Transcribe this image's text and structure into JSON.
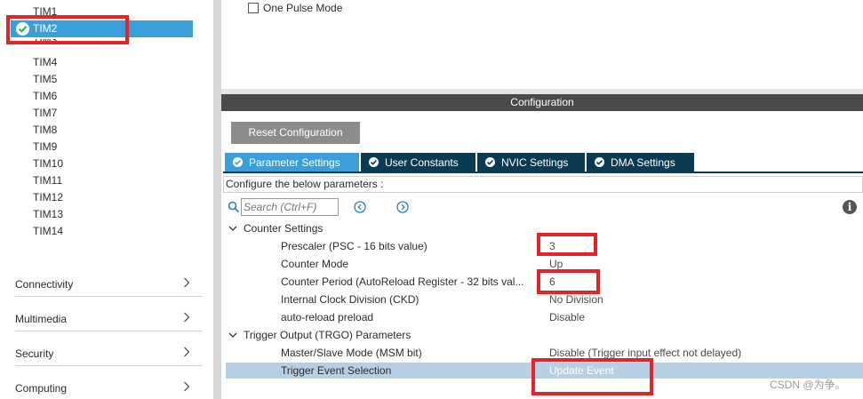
{
  "sidebar": {
    "timers": [
      "TIM1",
      "TIM2",
      "TIM3",
      "TIM4",
      "TIM5",
      "TIM6",
      "TIM7",
      "TIM8",
      "TIM9",
      "TIM10",
      "TIM11",
      "TIM12",
      "TIM13",
      "TIM14"
    ],
    "selected": "TIM2",
    "categories": [
      "Connectivity",
      "Multimedia",
      "Security",
      "Computing"
    ]
  },
  "mode": {
    "one_pulse_label": "One Pulse Mode",
    "one_pulse_checked": false
  },
  "config": {
    "header": "Configuration",
    "reset_button": "Reset Configuration",
    "tabs": [
      "Parameter Settings",
      "User Constants",
      "NVIC Settings",
      "DMA Settings"
    ],
    "active_tab": "Parameter Settings",
    "description": "Configure the below parameters :",
    "search_placeholder": "Search (Ctrl+F)",
    "groups": [
      {
        "title": "Counter Settings",
        "params": [
          {
            "name": "Prescaler (PSC - 16 bits value)",
            "value": "3"
          },
          {
            "name": "Counter Mode",
            "value": "Up"
          },
          {
            "name": "Counter Period (AutoReload Register - 32 bits val...",
            "value": "6"
          },
          {
            "name": "Internal Clock Division (CKD)",
            "value": "No Division"
          },
          {
            "name": "auto-reload preload",
            "value": "Disable"
          }
        ]
      },
      {
        "title": "Trigger Output (TRGO) Parameters",
        "params": [
          {
            "name": "Master/Slave Mode (MSM bit)",
            "value": "Disable (Trigger input effect not delayed)"
          },
          {
            "name": "Trigger Event Selection",
            "value": "Update Event"
          }
        ]
      }
    ]
  },
  "watermark": "CSDN @为争。",
  "colors": {
    "selection_blue": "#3a9fd8",
    "tab_dark": "#0b3b52",
    "header_gray": "#4a4a4a",
    "highlight_red": "#e52429",
    "selected_row": "#b7cfe2"
  }
}
